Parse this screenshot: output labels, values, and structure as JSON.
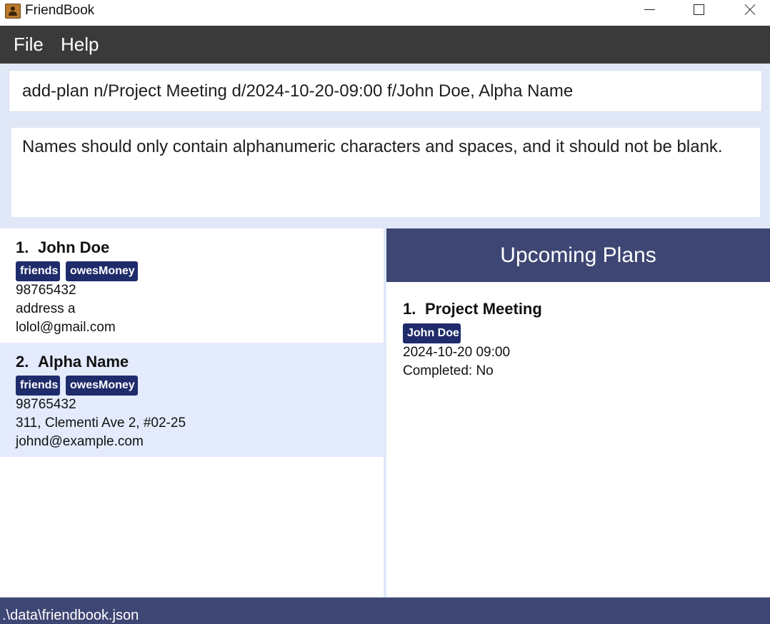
{
  "window": {
    "title": "FriendBook",
    "icon": "address-book-icon"
  },
  "menu": {
    "items": [
      "File",
      "Help"
    ]
  },
  "command": {
    "value": "add-plan n/Project Meeting d/2024-10-20-09:00 f/John Doe, Alpha Name"
  },
  "result": {
    "message": "Names should only contain alphanumeric characters and spaces, and it should not be blank."
  },
  "persons": [
    {
      "index": "1.",
      "name": "John Doe",
      "tags": [
        "friends",
        "owesMoney"
      ],
      "phone": "98765432",
      "address": "address a",
      "email": "lolol@gmail.com"
    },
    {
      "index": "2.",
      "name": "Alpha Name",
      "tags": [
        "friends",
        "owesMoney"
      ],
      "phone": "98765432",
      "address": "311, Clementi Ave 2, #02-25",
      "email": "johnd@example.com"
    }
  ],
  "plans": {
    "heading": "Upcoming Plans",
    "items": [
      {
        "index": "1.",
        "name": "Project Meeting",
        "friends": [
          "John Doe"
        ],
        "datetime": "2024-10-20 09:00",
        "status": "Completed: No"
      }
    ]
  },
  "status_bar": {
    "path": ".\\data\\friendbook.json"
  },
  "colors": {
    "menu_bg": "#3a3a3a",
    "panel_bg": "#e0e8f8",
    "tag_bg": "#1f2c6b",
    "header_bg": "#3e4673",
    "selected_row": "#e4ebfd"
  }
}
